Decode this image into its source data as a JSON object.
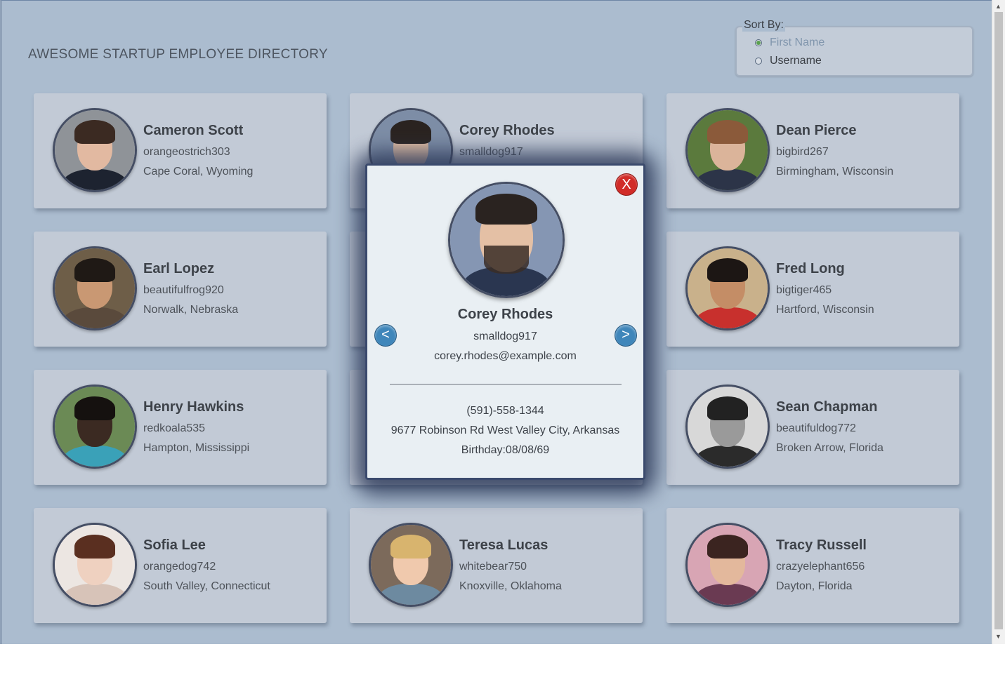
{
  "header": {
    "title": "AWESOME STARTUP EMPLOYEE DIRECTORY"
  },
  "sort": {
    "legend": "Sort By:",
    "options": [
      {
        "label": "First Name",
        "selected": true
      },
      {
        "label": "Username",
        "selected": false
      }
    ]
  },
  "employees": [
    {
      "name": "Cameron Scott",
      "username": "orangeostrich303",
      "location": "Cape Coral, Wyoming"
    },
    {
      "name": "Corey Rhodes",
      "username": "smalldog917",
      "location": ""
    },
    {
      "name": "Dean Pierce",
      "username": "bigbird267",
      "location": "Birmingham, Wisconsin"
    },
    {
      "name": "Earl Lopez",
      "username": "beautifulfrog920",
      "location": "Norwalk, Nebraska"
    },
    {
      "name": "",
      "username": "",
      "location": ""
    },
    {
      "name": "Fred Long",
      "username": "bigtiger465",
      "location": "Hartford, Wisconsin"
    },
    {
      "name": "Henry Hawkins",
      "username": "redkoala535",
      "location": "Hampton, Mississippi"
    },
    {
      "name": "",
      "username": "",
      "location": ""
    },
    {
      "name": "Sean Chapman",
      "username": "beautifuldog772",
      "location": "Broken Arrow, Florida"
    },
    {
      "name": "Sofia Lee",
      "username": "orangedog742",
      "location": "South Valley, Connecticut"
    },
    {
      "name": "Teresa Lucas",
      "username": "whitebear750",
      "location": "Knoxville, Oklahoma"
    },
    {
      "name": "Tracy Russell",
      "username": "crazyelephant656",
      "location": "Dayton, Florida"
    }
  ],
  "modal": {
    "close_label": "X",
    "prev_icon": "chevron-left-icon",
    "next_icon": "chevron-right-icon",
    "prev_glyph": "<",
    "next_glyph": ">",
    "name": "Corey Rhodes",
    "username": "smalldog917",
    "email": "corey.rhodes@example.com",
    "phone": "(591)-558-1344",
    "address": "9677 Robinson Rd West Valley City, Arkansas",
    "birthday": "Birthday:08/08/69"
  },
  "colors": {
    "background": "#abbccf",
    "card": "#c2cad6",
    "modal": "#e9eff3",
    "close_button": "#d12c28",
    "nav_button": "#3f86ba"
  }
}
